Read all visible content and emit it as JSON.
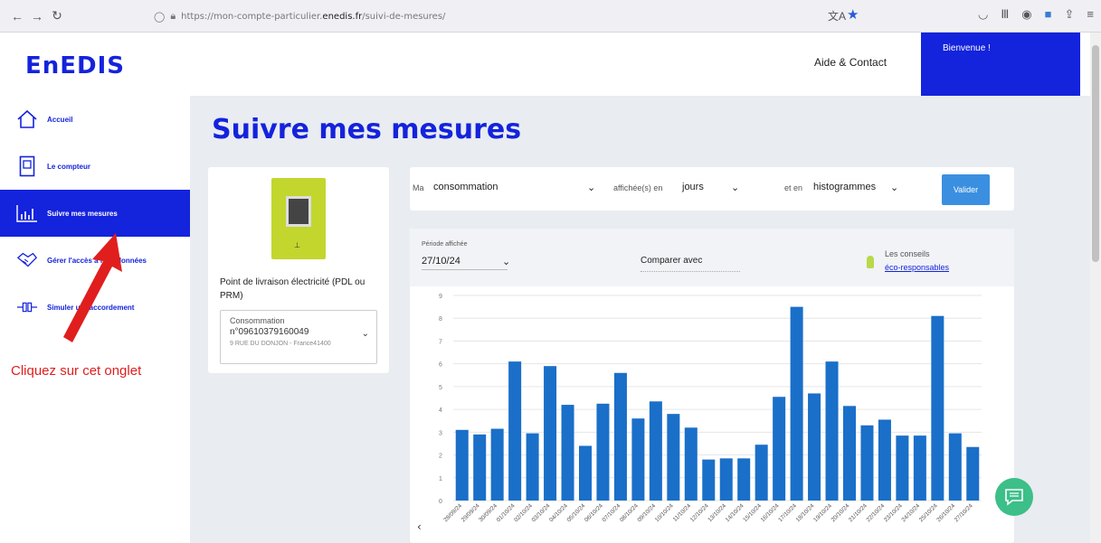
{
  "browser": {
    "url_prefix": "https://mon-compte-particulier.",
    "url_host": "enedis.fr",
    "url_path": "/suivi-de-mesures/"
  },
  "header": {
    "logo": "EnEDIS",
    "help": "Aide & Contact",
    "welcome": "Bienvenue !"
  },
  "sidebar": {
    "items": [
      {
        "label": "Accueil",
        "icon": "home-icon"
      },
      {
        "label": "Le compteur",
        "icon": "meter-icon"
      },
      {
        "label": "Suivre mes mesures",
        "icon": "bar-chart-icon"
      },
      {
        "label": "Gérer l'accès à mes données",
        "icon": "handshake-icon"
      },
      {
        "label": "Simuler un raccordement",
        "icon": "plug-icon"
      }
    ]
  },
  "main": {
    "title": "Suivre mes mesures"
  },
  "pdl": {
    "label": "Point de livraison électricité (PDL ou PRM)",
    "select_label": "Consommation",
    "number": "n°09610379160049",
    "address": "9 RUE DU DONJON - France41400"
  },
  "filters": {
    "prefix": "Ma",
    "measure": "consommation",
    "shown_in": "affichée(s) en",
    "unit": "jours",
    "and_in": "et en",
    "view": "histogrammes",
    "validate": "Valider"
  },
  "chart_head": {
    "period_label": "Période affichée",
    "period_value": "27/10/24",
    "compare": "Comparer avec",
    "tips_label": "Les conseils",
    "tips_link": "éco-responsables"
  },
  "annotation": "Cliquez sur cet onglet",
  "colors": {
    "brand": "#1423dc",
    "bar": "#1a6fc9",
    "accent_green": "#96cd32",
    "annotation": "#e01e1e"
  },
  "chart_data": {
    "type": "bar",
    "categories": [
      "28/09/24",
      "29/09/24",
      "30/09/24",
      "01/10/24",
      "02/10/24",
      "03/10/24",
      "04/10/24",
      "05/10/24",
      "06/10/24",
      "07/10/24",
      "08/10/24",
      "09/10/24",
      "10/10/24",
      "11/10/24",
      "12/10/24",
      "13/10/24",
      "14/10/24",
      "15/10/24",
      "16/10/24",
      "17/10/24",
      "18/10/24",
      "19/10/24",
      "20/10/24",
      "21/10/24",
      "22/10/24",
      "23/10/24",
      "24/10/24",
      "25/10/24",
      "26/10/24",
      "27/10/24"
    ],
    "values": [
      3.1,
      2.9,
      3.15,
      6.1,
      2.95,
      5.9,
      4.2,
      2.4,
      4.25,
      5.6,
      3.6,
      4.35,
      3.8,
      3.2,
      1.8,
      1.85,
      1.85,
      2.45,
      4.55,
      8.5,
      4.7,
      6.1,
      4.15,
      3.3,
      3.55,
      2.85,
      2.85,
      8.1,
      2.95,
      2.35
    ],
    "ylim": [
      0,
      9
    ],
    "yticks": [
      0,
      1,
      2,
      3,
      4,
      5,
      6,
      7,
      8,
      9
    ],
    "grid": true
  }
}
